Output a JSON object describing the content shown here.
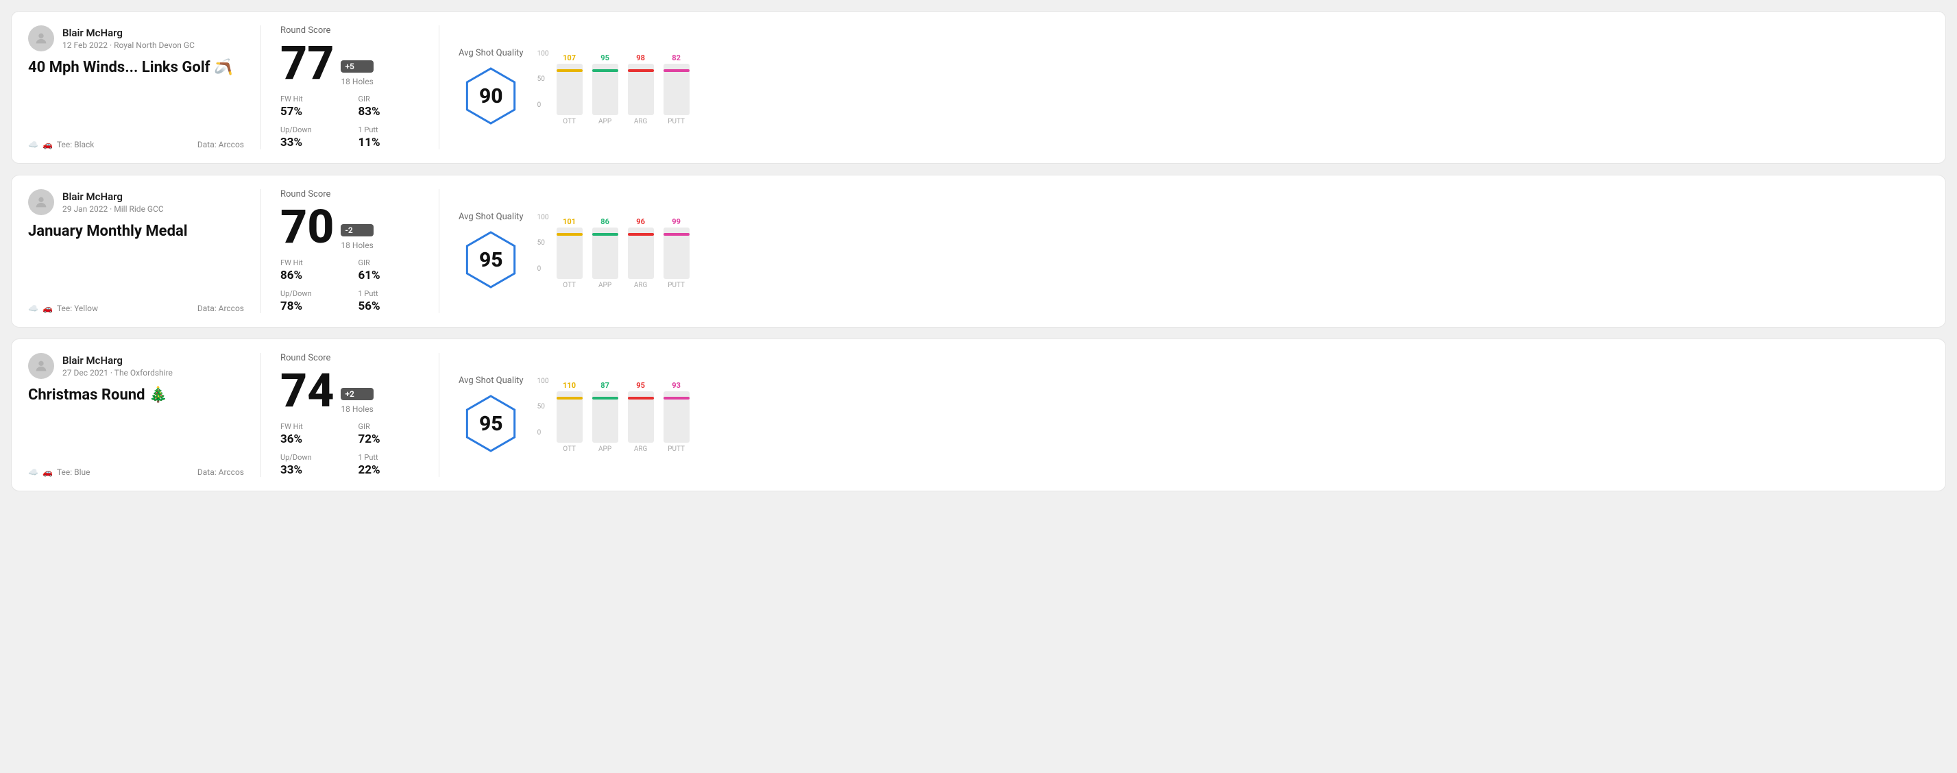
{
  "rounds": [
    {
      "id": "round-1",
      "user": {
        "name": "Blair McHarg",
        "date": "12 Feb 2022 · Royal North Devon GC"
      },
      "title": "40 Mph Winds... Links Golf 🪃",
      "tee": "Black",
      "data_source": "Data: Arccos",
      "score": {
        "label": "Round Score",
        "value": "77",
        "badge": "+5",
        "holes": "18 Holes"
      },
      "stats": {
        "fw_hit_label": "FW Hit",
        "fw_hit_value": "57%",
        "gir_label": "GIR",
        "gir_value": "83%",
        "updown_label": "Up/Down",
        "updown_value": "33%",
        "oneputt_label": "1 Putt",
        "oneputt_value": "11%"
      },
      "quality": {
        "label": "Avg Shot Quality",
        "score": "90",
        "hex_color": "#2b7be0"
      },
      "chart": {
        "bars": [
          {
            "label": "OTT",
            "value": 107,
            "color": "#e8b400",
            "max": 120
          },
          {
            "label": "APP",
            "value": 95,
            "color": "#22b573",
            "max": 120
          },
          {
            "label": "ARG",
            "value": 98,
            "color": "#e83030",
            "max": 120
          },
          {
            "label": "PUTT",
            "value": 82,
            "color": "#e040a0",
            "max": 120
          }
        ],
        "y_labels": [
          "100",
          "50",
          "0"
        ]
      }
    },
    {
      "id": "round-2",
      "user": {
        "name": "Blair McHarg",
        "date": "29 Jan 2022 · Mill Ride GCC"
      },
      "title": "January Monthly Medal",
      "tee": "Yellow",
      "data_source": "Data: Arccos",
      "score": {
        "label": "Round Score",
        "value": "70",
        "badge": "-2",
        "holes": "18 Holes"
      },
      "stats": {
        "fw_hit_label": "FW Hit",
        "fw_hit_value": "86%",
        "gir_label": "GIR",
        "gir_value": "61%",
        "updown_label": "Up/Down",
        "updown_value": "78%",
        "oneputt_label": "1 Putt",
        "oneputt_value": "56%"
      },
      "quality": {
        "label": "Avg Shot Quality",
        "score": "95",
        "hex_color": "#2b7be0"
      },
      "chart": {
        "bars": [
          {
            "label": "OTT",
            "value": 101,
            "color": "#e8b400",
            "max": 120
          },
          {
            "label": "APP",
            "value": 86,
            "color": "#22b573",
            "max": 120
          },
          {
            "label": "ARG",
            "value": 96,
            "color": "#e83030",
            "max": 120
          },
          {
            "label": "PUTT",
            "value": 99,
            "color": "#e040a0",
            "max": 120
          }
        ],
        "y_labels": [
          "100",
          "50",
          "0"
        ]
      }
    },
    {
      "id": "round-3",
      "user": {
        "name": "Blair McHarg",
        "date": "27 Dec 2021 · The Oxfordshire"
      },
      "title": "Christmas Round 🎄",
      "tee": "Blue",
      "data_source": "Data: Arccos",
      "score": {
        "label": "Round Score",
        "value": "74",
        "badge": "+2",
        "holes": "18 Holes"
      },
      "stats": {
        "fw_hit_label": "FW Hit",
        "fw_hit_value": "36%",
        "gir_label": "GIR",
        "gir_value": "72%",
        "updown_label": "Up/Down",
        "updown_value": "33%",
        "oneputt_label": "1 Putt",
        "oneputt_value": "22%"
      },
      "quality": {
        "label": "Avg Shot Quality",
        "score": "95",
        "hex_color": "#2b7be0"
      },
      "chart": {
        "bars": [
          {
            "label": "OTT",
            "value": 110,
            "color": "#e8b400",
            "max": 120
          },
          {
            "label": "APP",
            "value": 87,
            "color": "#22b573",
            "max": 120
          },
          {
            "label": "ARG",
            "value": 95,
            "color": "#e83030",
            "max": 120
          },
          {
            "label": "PUTT",
            "value": 93,
            "color": "#e040a0",
            "max": 120
          }
        ],
        "y_labels": [
          "100",
          "50",
          "0"
        ]
      }
    }
  ]
}
